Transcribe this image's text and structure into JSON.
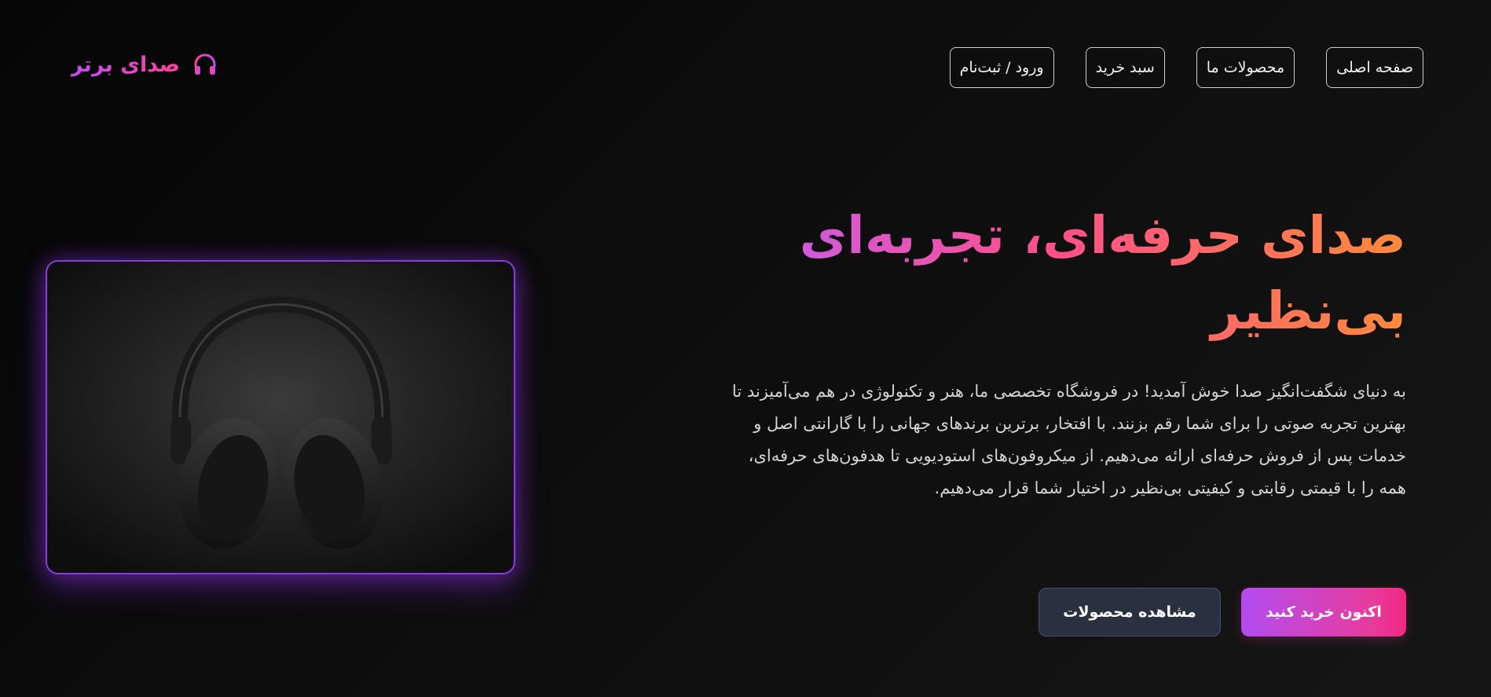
{
  "brand": {
    "name": "صدای برتر",
    "icon": "headphones-icon",
    "color_from": "#c04df2",
    "color_to": "#ff3f9e"
  },
  "nav": {
    "items": [
      {
        "label": "صفحه اصلی"
      },
      {
        "label": "محصولات ما"
      },
      {
        "label": "سبد خرید"
      },
      {
        "label": "ورود / ثبت‌نام"
      }
    ]
  },
  "hero": {
    "title": "صدای حرفه‌ای، تجربه‌ای بی‌نظیر",
    "description": "به دنیای شگفت‌انگیز صدا خوش آمدید! در فروشگاه تخصصی ما، هنر و تکنولوژی در هم می‌آمیزند تا بهترین تجربه صوتی را برای شما رقم بزنند. با افتخار، برترین برندهای جهانی را با گارانتی اصل و خدمات پس از فروش حرفه‌ای ارائه می‌دهیم. از میکروفون‌های استودیویی تا هدفون‌های حرفه‌ای، همه را با قیمتی رقابتی و کیفیتی بی‌نظیر در اختیار شما قرار می‌دهیم.",
    "image": "headphones-product-photo",
    "primary_cta": "اکنون خرید کنید",
    "secondary_cta": "مشاهده محصولات"
  },
  "colors": {
    "background": "#0d0d0d",
    "accent_purple": "#8a3be0",
    "accent_pink": "#e93b9c",
    "accent_orange": "#ff8a3a"
  }
}
